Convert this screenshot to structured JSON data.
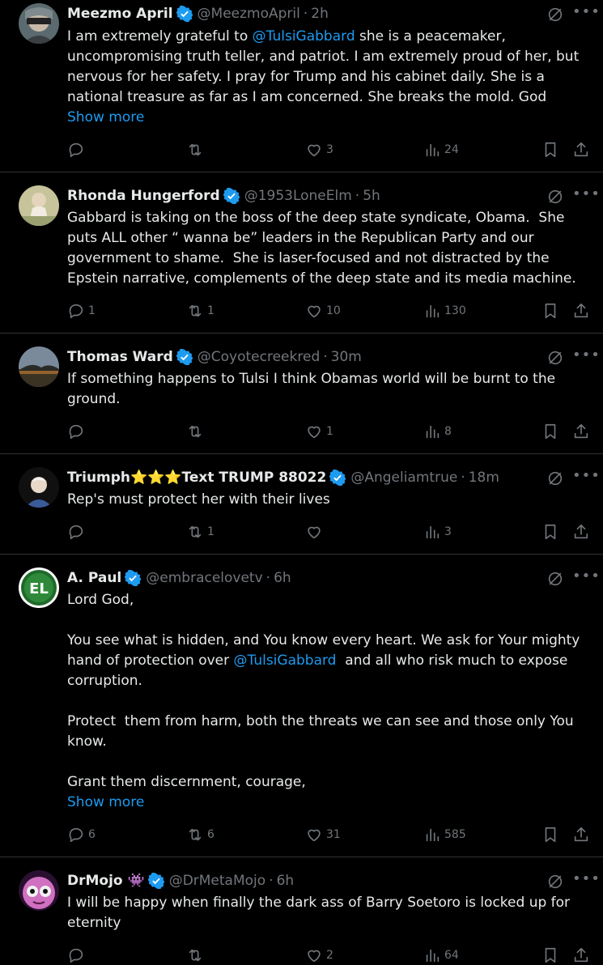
{
  "colors": {
    "background": "#000000",
    "text": "#e7e9ea",
    "muted": "#71767b",
    "link": "#1d9bf0",
    "verified": "#1d9bf0",
    "divider": "#2f3336"
  },
  "icons": {
    "reply": "reply-icon",
    "repost": "repost-icon",
    "like": "heart-icon",
    "views": "views-icon",
    "bookmark": "bookmark-icon",
    "share": "share-icon",
    "grok": "grok-icon",
    "more": "more-icon",
    "verified": "verified-badge-icon"
  },
  "tweets": [
    {
      "name": "Meezmo April",
      "handle": "@MeezmoApril",
      "time": "2h",
      "text_parts": [
        {
          "t": "I am extremely grateful to "
        },
        {
          "t": "@TulsiGabbard",
          "mention": true
        },
        {
          "t": " she is a peacemaker,\nuncompromising truth teller, and patriot. I am extremely proud of her, but\nnervous for her safety. I pray for Trump and his cabinet daily. She is a\nnational treasure as far as I am concerned. She breaks the mold. God"
        }
      ],
      "show_more": "Show more",
      "replies": "",
      "reposts": "",
      "likes": "3",
      "views": "24"
    },
    {
      "name": "Rhonda Hungerford",
      "handle": "@1953LoneElm",
      "time": "5h",
      "text_parts": [
        {
          "t": "Gabbard is taking on the boss of the deep state syndicate, Obama.  She\nputs ALL other “ wanna be” leaders in the Republican Party and our\ngovernment to shame.  She is laser-focused and not distracted by the\nEpstein narrative, complements of the deep state and its media machine."
        }
      ],
      "show_more": "",
      "replies": "1",
      "reposts": "1",
      "likes": "10",
      "views": "130"
    },
    {
      "name": "Thomas Ward",
      "handle": "@Coyotecreekred",
      "time": "30m",
      "text_parts": [
        {
          "t": "If something happens to Tulsi I think Obamas world will be burnt to the\nground."
        }
      ],
      "show_more": "",
      "replies": "",
      "reposts": "",
      "likes": "1",
      "views": "8"
    },
    {
      "name": "Triumph⭐⭐⭐Text TRUMP 88022",
      "handle": "@Angeliamtrue",
      "time": "18m",
      "text_parts": [
        {
          "t": "Rep's must protect her with their lives"
        }
      ],
      "show_more": "",
      "replies": "",
      "reposts": "1",
      "likes": "",
      "views": "3"
    },
    {
      "name": "A. Paul",
      "handle": "@embracelovetv",
      "time": "6h",
      "text_parts": [
        {
          "t": "Lord God,\n\nYou see what is hidden, and You know every heart. We ask for Your mighty\nhand of protection over "
        },
        {
          "t": "@TulsiGabbard",
          "mention": true
        },
        {
          "t": "  and all who risk much to expose\ncorruption.\n\nProtect  them from harm, both the threats we can see and those only You\nknow.\n\nGrant them discernment, courage,"
        }
      ],
      "show_more": "Show more",
      "replies": "6",
      "reposts": "6",
      "likes": "31",
      "views": "585"
    },
    {
      "name": "DrMojo 👾",
      "handle": "@DrMetaMojo",
      "time": "6h",
      "text_parts": [
        {
          "t": "I will be happy when finally the dark ass of Barry Soetoro is locked up for\neternity"
        }
      ],
      "show_more": "",
      "replies": "",
      "reposts": "",
      "likes": "2",
      "views": "64"
    }
  ]
}
